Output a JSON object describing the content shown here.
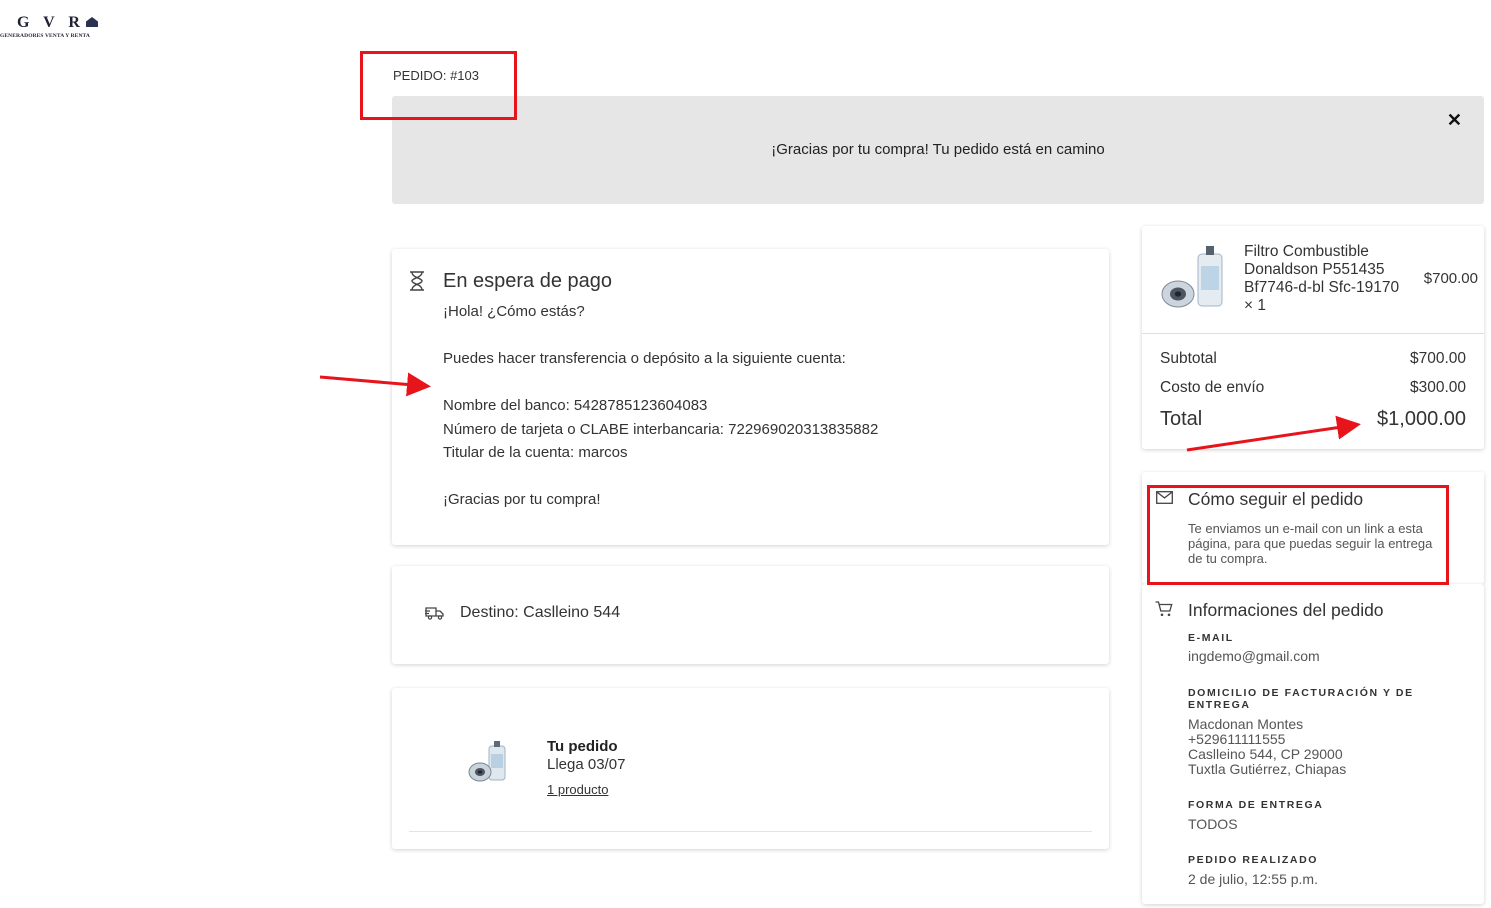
{
  "logo": {
    "mark": "G V R",
    "subtitle": "GENERADORES VENTA Y RENTA"
  },
  "order": {
    "number_label": "PEDIDO: #103"
  },
  "banner": {
    "message": "¡Gracias por tu compra! Tu pedido está en camino",
    "close": "✕"
  },
  "payment": {
    "icon": "hourglass-icon",
    "title": "En espera de pago",
    "greeting": "¡Hola! ¿Cómo estás?",
    "instruction": "Puedes hacer transferencia o depósito a la siguiente cuenta:",
    "bank": "Nombre del banco: 5428785123604083",
    "clabe": "Número de tarjeta o CLABE interbancaria: 722969020313835882",
    "holder": "Titular de la cuenta: marcos",
    "thanks": "¡Gracias por tu compra!"
  },
  "destination": {
    "icon": "truck-icon",
    "text": "Destino: Caslleino 544"
  },
  "shipment": {
    "title": "Tu pedido",
    "arrival": "Llega 03/07",
    "products_link": "1 producto"
  },
  "summary": {
    "product": {
      "name": "Filtro Combustible Donaldson P551435 Bf7746-d-bl Sfc-19170 × 1",
      "price": "$700.00"
    },
    "subtotal_label": "Subtotal",
    "subtotal": "$700.00",
    "shipping_label": "Costo de envío",
    "shipping": "$300.00",
    "total_label": "Total",
    "total": "$1,000.00"
  },
  "tracking": {
    "icon": "mail-icon",
    "title": "Cómo seguir el pedido",
    "body": "Te enviamos un e-mail con un link a esta página, para que puedas seguir la entrega de tu compra."
  },
  "info": {
    "icon": "cart-icon",
    "title": "Informaciones del pedido",
    "email_label": "E-MAIL",
    "email": "ingdemo@gmail.com",
    "address_label": "DOMICILIO DE FACTURACIÓN Y DE ENTREGA",
    "address_name": "Macdonan Montes",
    "address_phone": "+529611111555",
    "address_street": "Caslleino 544, CP 29000",
    "address_city": "Tuxtla Gutiérrez, Chiapas",
    "delivery_label": "FORMA DE ENTREGA",
    "delivery": "TODOS",
    "placed_label": "PEDIDO REALIZADO",
    "placed": "2 de julio, 12:55 p.m."
  },
  "annotation_color": "#e8141b"
}
